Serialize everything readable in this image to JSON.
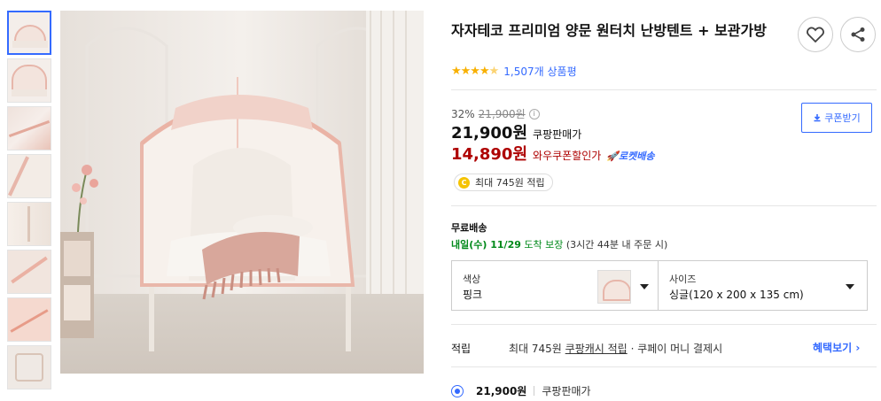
{
  "gallery": {
    "thumbnails": [
      "thumb-1",
      "thumb-2",
      "thumb-3",
      "thumb-4",
      "thumb-5",
      "thumb-6",
      "thumb-7",
      "thumb-8"
    ],
    "active_index": 0
  },
  "product": {
    "title": "자자테코 프리미엄 양문 원터치 난방텐트 + 보관가방",
    "rating_stars": 4.5,
    "review_count": "1,507개 상품평"
  },
  "price": {
    "discount_rate": "32%",
    "original_price": "21,900원",
    "info_icon": "i",
    "sale_price": "21,900원",
    "sale_label": "쿠팡판매가",
    "wow_price": "14,890원",
    "wow_label": "와우쿠폰할인가",
    "rocket_label": "로켓배송",
    "coupon_button": "쿠폰받기",
    "point_coin": "C",
    "point_text": "최대 745원 적립"
  },
  "shipping": {
    "title": "무료배송",
    "date": "내일(수) 11/29",
    "arrival": "도착 보장",
    "condition": "(3시간 44분 내 주문 시)"
  },
  "options": {
    "color_label": "색상",
    "color_value": "핑크",
    "size_label": "사이즈",
    "size_value": "싱글(120 x 200 x 135 cm)"
  },
  "rewards": {
    "title": "적립",
    "prefix": "최대 745원",
    "link": "쿠팡캐시 적립",
    "suffix": "· 쿠페이 머니 결제시",
    "more": "혜택보기"
  },
  "seller": {
    "price": "21,900원",
    "name": "쿠팡판매가"
  },
  "colors": {
    "accent": "#346aff",
    "wow": "#ae0000",
    "ship_date": "#00891a",
    "star": "#f8b000"
  }
}
